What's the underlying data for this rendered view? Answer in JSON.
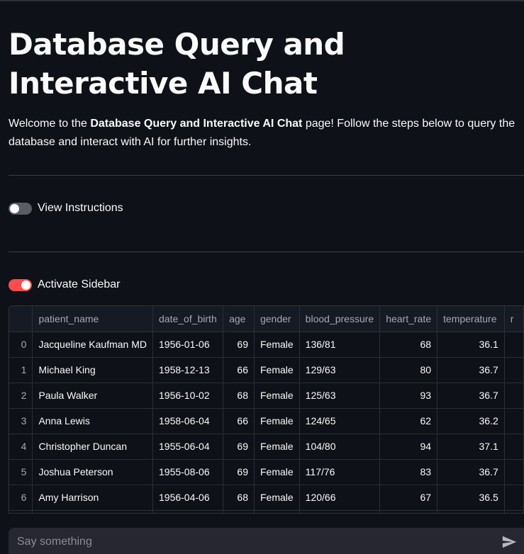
{
  "header": {
    "title": "Database Query and Interactive AI Chat",
    "intro_prefix": "Welcome to the ",
    "intro_bold": "Database Query and Interactive AI Chat",
    "intro_suffix": " page! Follow the steps below to query the database and interact with AI for further insights."
  },
  "instructions_toggle": {
    "label": "View Instructions",
    "checked": false
  },
  "sidebar_toggle": {
    "label": "Activate Sidebar",
    "checked": true,
    "accent_color": "#ff4b4b"
  },
  "table": {
    "columns": [
      "",
      "patient_name",
      "date_of_birth",
      "age",
      "gender",
      "blood_pressure",
      "heart_rate",
      "temperature",
      "r"
    ],
    "rows": [
      [
        "0",
        "Jacqueline Kaufman MD",
        "1956-01-06",
        "69",
        "Female",
        "136/81",
        "68",
        "36.1",
        ""
      ],
      [
        "1",
        "Michael King",
        "1958-12-13",
        "66",
        "Female",
        "129/63",
        "80",
        "36.7",
        ""
      ],
      [
        "2",
        "Paula Walker",
        "1956-10-02",
        "68",
        "Female",
        "125/63",
        "93",
        "36.7",
        ""
      ],
      [
        "3",
        "Anna Lewis",
        "1958-06-04",
        "66",
        "Female",
        "124/65",
        "62",
        "36.2",
        ""
      ],
      [
        "4",
        "Christopher Duncan",
        "1955-06-04",
        "69",
        "Female",
        "104/80",
        "94",
        "37.1",
        ""
      ],
      [
        "5",
        "Joshua Peterson",
        "1955-08-06",
        "69",
        "Female",
        "117/76",
        "83",
        "36.7",
        ""
      ],
      [
        "6",
        "Amy Harrison",
        "1956-04-06",
        "68",
        "Female",
        "120/66",
        "67",
        "36.5",
        ""
      ],
      [
        "",
        "",
        "",
        "",
        "",
        "",
        "",
        "",
        ""
      ]
    ]
  },
  "chat": {
    "placeholder": "Say something",
    "send_icon": "send-icon"
  },
  "theme": {
    "background": "#0e1117",
    "input_background": "#262730",
    "text": "#fafafa"
  }
}
